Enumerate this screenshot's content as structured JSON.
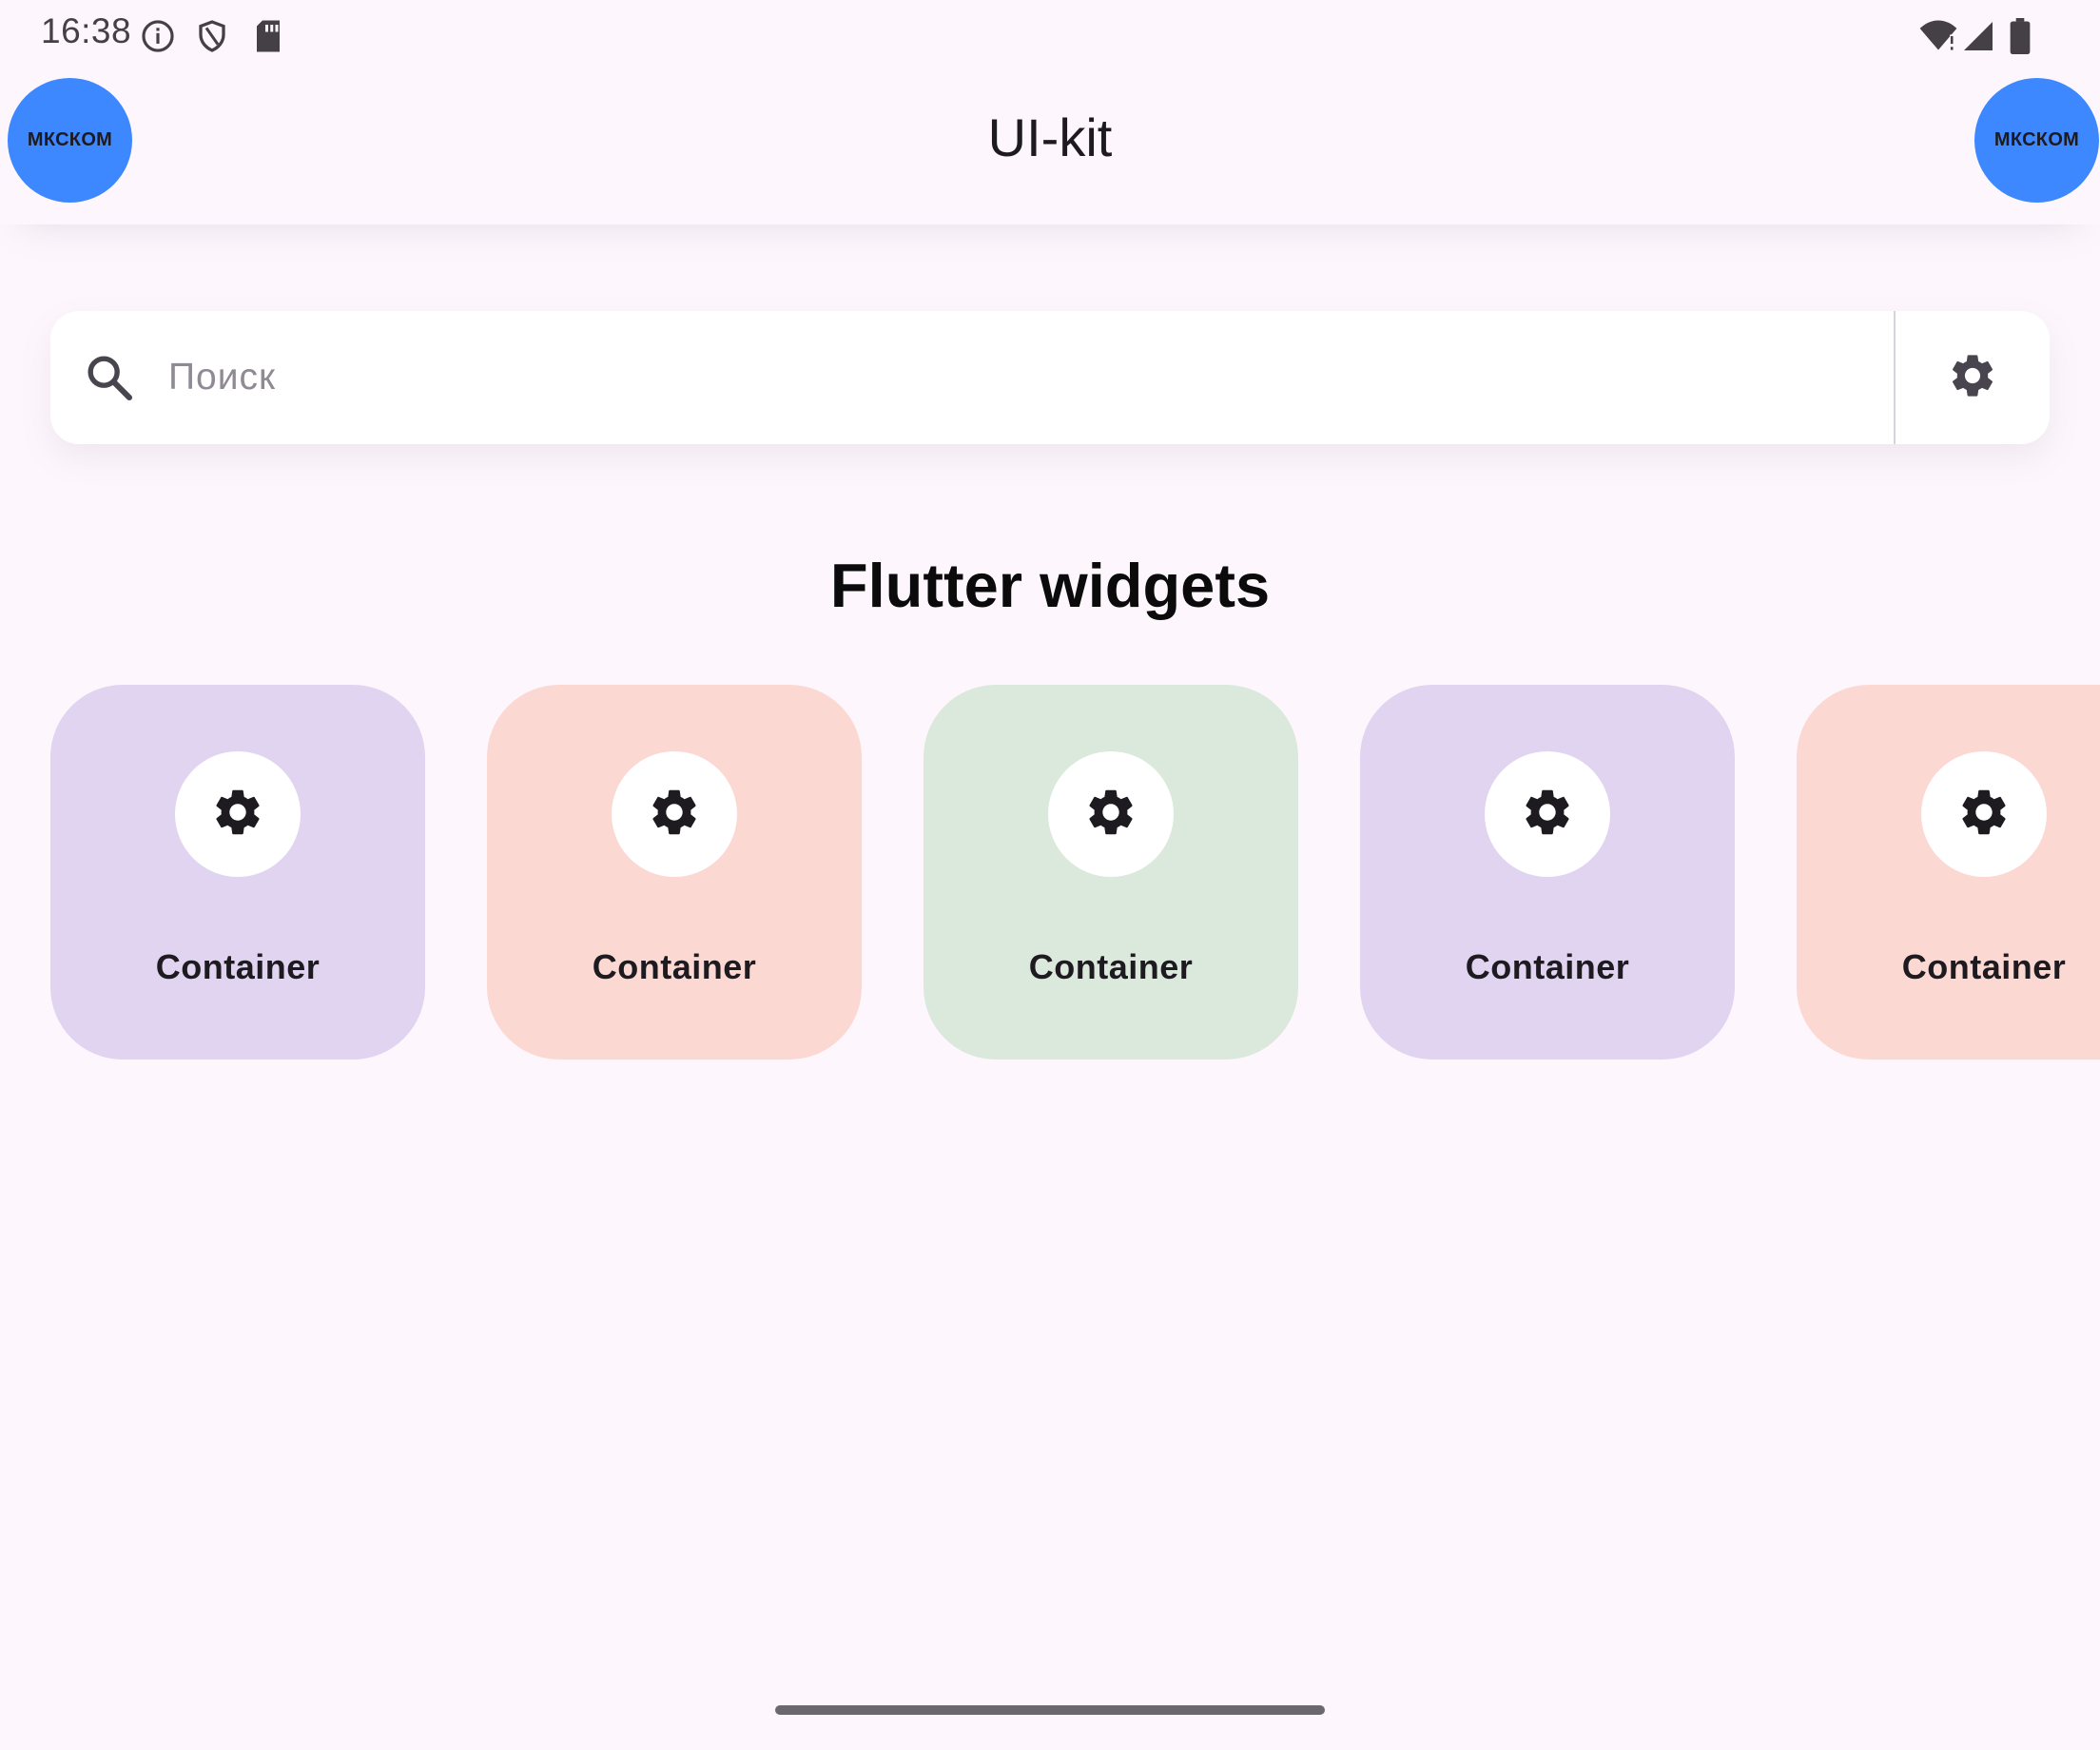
{
  "status_bar": {
    "time": "16:38",
    "icons": [
      "info-icon",
      "shield-icon",
      "sd-card-icon",
      "wifi-alert-icon",
      "signal-icon",
      "battery-icon"
    ]
  },
  "app_bar": {
    "title": "UI-kit",
    "left_avatar_label": "МКСКОМ",
    "right_avatar_label": "МКСКОМ",
    "avatar_color": "#3d87ff"
  },
  "search": {
    "placeholder": "Поиск",
    "value": ""
  },
  "section": {
    "title": "Flutter widgets"
  },
  "cards": [
    {
      "label": "Container",
      "color": "#e0d4f1",
      "icon": "gear-icon"
    },
    {
      "label": "Container",
      "color": "#fcd8d3",
      "icon": "gear-icon"
    },
    {
      "label": "Container",
      "color": "#dbe9dd",
      "icon": "gear-icon"
    },
    {
      "label": "Container",
      "color": "#e0d4f1",
      "icon": "gear-icon"
    },
    {
      "label": "Container",
      "color": "#fcd8d3",
      "icon": "gear-icon"
    }
  ],
  "colors": {
    "background": "#fdf7fd",
    "search_background": "#ffffff",
    "icon": "#49454f"
  }
}
